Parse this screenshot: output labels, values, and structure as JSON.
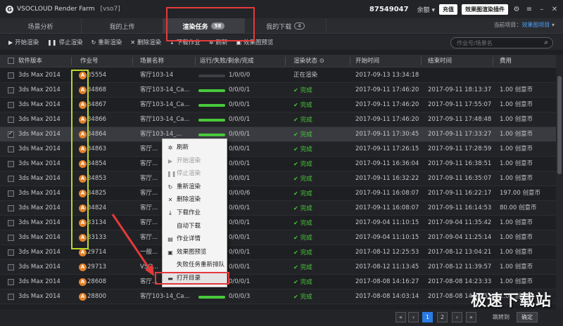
{
  "app": {
    "title": "VSOCLOUD Render Farm",
    "server": "[vso7]",
    "account": "87549047",
    "balance_label": "余额",
    "recharge": "充值",
    "plugin": "效果图渲染插件"
  },
  "tabs": [
    {
      "label": "场景分析"
    },
    {
      "label": "我的上传"
    },
    {
      "label": "渲染任务",
      "badge": "58",
      "active": true
    },
    {
      "label": "我的下载",
      "badge": "4"
    }
  ],
  "project": {
    "label": "当前项目：",
    "value": "效果图项目"
  },
  "toolbar": {
    "items": [
      {
        "icon": "▶",
        "label": "开始渲染"
      },
      {
        "icon": "❚❚",
        "label": "停止渲染"
      },
      {
        "icon": "↻",
        "label": "重新渲染"
      },
      {
        "icon": "✕",
        "label": "删除渲染"
      },
      {
        "icon": "↓",
        "label": "下载作业"
      },
      {
        "icon": "✲",
        "label": "刷新"
      },
      {
        "icon": "▣",
        "label": "效果图预览"
      }
    ],
    "search_placeholder": "作业号/场景名"
  },
  "columns": {
    "software": "软件版本",
    "job": "作业号",
    "scene": "场景名称",
    "progress": "运行/失败/剩余/完成",
    "status": "渲染状态",
    "start": "开始时间",
    "end": "结束时间",
    "cost": "费用"
  },
  "rows": [
    {
      "sw": "3ds Max 2014",
      "job": "35554",
      "scene": "客厅103-14",
      "progress": 0,
      "counts": "1/0/0/0",
      "status": "正在渲染",
      "done": false,
      "start": "2017-09-13 13:34:18",
      "end": "",
      "cost": ""
    },
    {
      "sw": "3ds Max 2014",
      "job": "34868",
      "scene": "客厅103-14_Ca...",
      "progress": 1,
      "counts": "0/0/0/1",
      "status": "完成",
      "done": true,
      "start": "2017-09-11 17:46:20",
      "end": "2017-09-11 18:13:37",
      "cost": "1.00 创意币"
    },
    {
      "sw": "3ds Max 2014",
      "job": "34867",
      "scene": "客厅103-14_Ca...",
      "progress": 1,
      "counts": "0/0/0/1",
      "status": "完成",
      "done": true,
      "start": "2017-09-11 17:46:20",
      "end": "2017-09-11 17:55:07",
      "cost": "1.00 创意币"
    },
    {
      "sw": "3ds Max 2014",
      "job": "34866",
      "scene": "客厅103-14_Ca...",
      "progress": 1,
      "counts": "0/0/0/1",
      "status": "完成",
      "done": true,
      "start": "2017-09-11 17:46:20",
      "end": "2017-09-11 17:48:48",
      "cost": "1.00 创意币"
    },
    {
      "sw": "3ds Max 2014",
      "job": "34864",
      "scene": "客厅103-14_...",
      "progress": 1,
      "counts": "0/0/0/1",
      "status": "完成",
      "done": true,
      "start": "2017-09-11 17:30:45",
      "end": "2017-09-11 17:33:27",
      "cost": "1.00 创意币",
      "selected": true
    },
    {
      "sw": "3ds Max 2014",
      "job": "34863",
      "scene": "客厅...",
      "progress": 1,
      "counts": "0/0/0/1",
      "status": "完成",
      "done": true,
      "start": "2017-09-11 17:26:15",
      "end": "2017-09-11 17:28:59",
      "cost": "1.00 创意币"
    },
    {
      "sw": "3ds Max 2014",
      "job": "34854",
      "scene": "客厅...",
      "progress": 1,
      "counts": "0/0/0/1",
      "status": "完成",
      "done": true,
      "start": "2017-09-11 16:36:04",
      "end": "2017-09-11 16:38:51",
      "cost": "1.00 创意币"
    },
    {
      "sw": "3ds Max 2014",
      "job": "34853",
      "scene": "客厅...",
      "progress": 1,
      "counts": "0/0/0/1",
      "status": "完成",
      "done": true,
      "start": "2017-09-11 16:32:22",
      "end": "2017-09-11 16:35:07",
      "cost": "1.00 创意币"
    },
    {
      "sw": "3ds Max 2014",
      "job": "34825",
      "scene": "客厅...",
      "progress": 1,
      "counts": "0/0/0/6",
      "status": "完成",
      "done": true,
      "start": "2017-09-11 16:08:07",
      "end": "2017-09-11 16:22:17",
      "cost": "197.00 创意币"
    },
    {
      "sw": "3ds Max 2014",
      "job": "34824",
      "scene": "客厅...",
      "progress": 1,
      "counts": "0/0/0/1",
      "status": "完成",
      "done": true,
      "start": "2017-09-11 16:08:07",
      "end": "2017-09-11 16:14:53",
      "cost": "80.00 创意币"
    },
    {
      "sw": "3ds Max 2014",
      "job": "33134",
      "scene": "客厅...",
      "progress": 1,
      "counts": "0/0/0/1",
      "status": "完成",
      "done": true,
      "start": "2017-09-04 11:10:15",
      "end": "2017-09-04 11:35:42",
      "cost": "1.00 创意币"
    },
    {
      "sw": "3ds Max 2014",
      "job": "33133",
      "scene": "客厅...",
      "progress": 1,
      "counts": "0/0/0/1",
      "status": "完成",
      "done": true,
      "start": "2017-09-04 11:10:15",
      "end": "2017-09-04 11:25:14",
      "cost": "1.00 创意币"
    },
    {
      "sw": "3ds Max 2014",
      "job": "29714",
      "scene": "一般...",
      "progress": 1,
      "counts": "0/0/0/1",
      "status": "完成",
      "done": true,
      "start": "2017-08-12 12:25:53",
      "end": "2017-08-12 13:04:21",
      "cost": "1.00 创意币"
    },
    {
      "sw": "3ds Max 2014",
      "job": "29713",
      "scene": "VSO...",
      "progress": 1,
      "counts": "0/0/0/1",
      "status": "完成",
      "done": true,
      "start": "2017-08-12 11:13:45",
      "end": "2017-08-12 11:39:57",
      "cost": "1.00 创意币"
    },
    {
      "sw": "3ds Max 2014",
      "job": "28608",
      "scene": "客厅...",
      "progress": 1,
      "counts": "0/0/0/1",
      "status": "完成",
      "done": true,
      "start": "2017-08-08 14:16:27",
      "end": "2017-08-08 14:23:33",
      "cost": "1.00 创意币"
    },
    {
      "sw": "3ds Max 2014",
      "job": "28800",
      "scene": "客厅103-14_Ca...",
      "progress": 1,
      "counts": "0/0/0/3",
      "status": "完成",
      "done": true,
      "start": "2017-08-08 14:03:14",
      "end": "2017-08-08 14:13:51",
      "cost": "1.00 创意币"
    }
  ],
  "context_menu": [
    {
      "icon": "✲",
      "label": "刷新",
      "disabled": false
    },
    {
      "icon": "▶",
      "label": "开始渲染",
      "disabled": true
    },
    {
      "icon": "❚❚",
      "label": "停止渲染",
      "disabled": true
    },
    {
      "icon": "↻",
      "label": "重新渲染",
      "disabled": false
    },
    {
      "icon": "✕",
      "label": "删除渲染",
      "disabled": false
    },
    {
      "icon": "↓",
      "label": "下载作业",
      "disabled": false
    },
    {
      "icon": "",
      "label": "自动下载",
      "disabled": false
    },
    {
      "icon": "▤",
      "label": "作业详情",
      "disabled": false
    },
    {
      "icon": "▣",
      "label": "效果图预览",
      "disabled": false
    },
    {
      "icon": "",
      "label": "失败任务重新排队",
      "disabled": false
    },
    {
      "icon": "▬",
      "label": "打开目录",
      "disabled": false,
      "highlight": true
    }
  ],
  "pager": {
    "first": "«",
    "prev": "‹",
    "pages": [
      "1",
      "2"
    ],
    "next": "›",
    "last": "»",
    "goto": "跳转到",
    "ok": "确定"
  },
  "watermark": "极速下载站",
  "colors": {
    "accent": "#2a7be4",
    "success": "#48c93a",
    "job_dot": "#e4812a",
    "annotation_red": "#e43a3a",
    "annotation_green": "#b9d72a"
  }
}
